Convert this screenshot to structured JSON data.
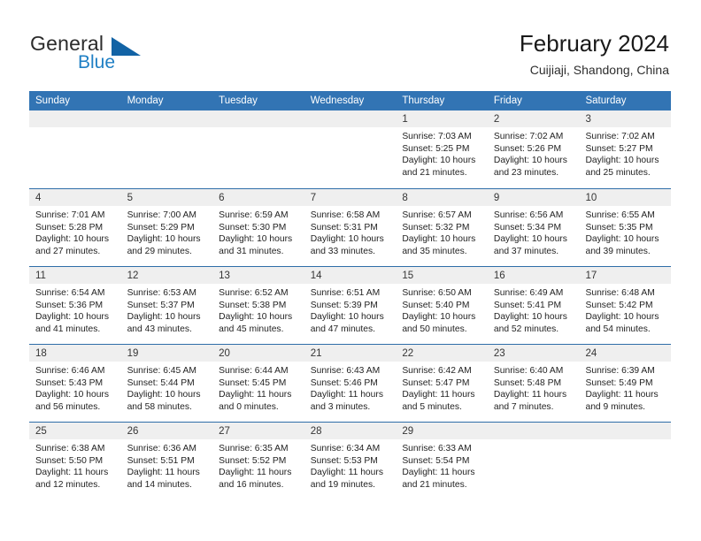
{
  "logo": {
    "word_top": "General",
    "word_bottom": "Blue",
    "accent_color": "#1263a5"
  },
  "header": {
    "title": "February 2024",
    "subtitle": "Cuijiaji, Shandong, China",
    "header_bg": "#3274b4",
    "row_divider": "#2f6da8",
    "daynum_band": "#efefef"
  },
  "weekdays": [
    "Sunday",
    "Monday",
    "Tuesday",
    "Wednesday",
    "Thursday",
    "Friday",
    "Saturday"
  ],
  "weeks": [
    [
      {
        "day": "",
        "empty": true
      },
      {
        "day": "",
        "empty": true
      },
      {
        "day": "",
        "empty": true
      },
      {
        "day": "",
        "empty": true
      },
      {
        "day": "1",
        "sunrise": "Sunrise: 7:03 AM",
        "sunset": "Sunset: 5:25 PM",
        "daylight1": "Daylight: 10 hours",
        "daylight2": "and 21 minutes."
      },
      {
        "day": "2",
        "sunrise": "Sunrise: 7:02 AM",
        "sunset": "Sunset: 5:26 PM",
        "daylight1": "Daylight: 10 hours",
        "daylight2": "and 23 minutes."
      },
      {
        "day": "3",
        "sunrise": "Sunrise: 7:02 AM",
        "sunset": "Sunset: 5:27 PM",
        "daylight1": "Daylight: 10 hours",
        "daylight2": "and 25 minutes."
      }
    ],
    [
      {
        "day": "4",
        "sunrise": "Sunrise: 7:01 AM",
        "sunset": "Sunset: 5:28 PM",
        "daylight1": "Daylight: 10 hours",
        "daylight2": "and 27 minutes."
      },
      {
        "day": "5",
        "sunrise": "Sunrise: 7:00 AM",
        "sunset": "Sunset: 5:29 PM",
        "daylight1": "Daylight: 10 hours",
        "daylight2": "and 29 minutes."
      },
      {
        "day": "6",
        "sunrise": "Sunrise: 6:59 AM",
        "sunset": "Sunset: 5:30 PM",
        "daylight1": "Daylight: 10 hours",
        "daylight2": "and 31 minutes."
      },
      {
        "day": "7",
        "sunrise": "Sunrise: 6:58 AM",
        "sunset": "Sunset: 5:31 PM",
        "daylight1": "Daylight: 10 hours",
        "daylight2": "and 33 minutes."
      },
      {
        "day": "8",
        "sunrise": "Sunrise: 6:57 AM",
        "sunset": "Sunset: 5:32 PM",
        "daylight1": "Daylight: 10 hours",
        "daylight2": "and 35 minutes."
      },
      {
        "day": "9",
        "sunrise": "Sunrise: 6:56 AM",
        "sunset": "Sunset: 5:34 PM",
        "daylight1": "Daylight: 10 hours",
        "daylight2": "and 37 minutes."
      },
      {
        "day": "10",
        "sunrise": "Sunrise: 6:55 AM",
        "sunset": "Sunset: 5:35 PM",
        "daylight1": "Daylight: 10 hours",
        "daylight2": "and 39 minutes."
      }
    ],
    [
      {
        "day": "11",
        "sunrise": "Sunrise: 6:54 AM",
        "sunset": "Sunset: 5:36 PM",
        "daylight1": "Daylight: 10 hours",
        "daylight2": "and 41 minutes."
      },
      {
        "day": "12",
        "sunrise": "Sunrise: 6:53 AM",
        "sunset": "Sunset: 5:37 PM",
        "daylight1": "Daylight: 10 hours",
        "daylight2": "and 43 minutes."
      },
      {
        "day": "13",
        "sunrise": "Sunrise: 6:52 AM",
        "sunset": "Sunset: 5:38 PM",
        "daylight1": "Daylight: 10 hours",
        "daylight2": "and 45 minutes."
      },
      {
        "day": "14",
        "sunrise": "Sunrise: 6:51 AM",
        "sunset": "Sunset: 5:39 PM",
        "daylight1": "Daylight: 10 hours",
        "daylight2": "and 47 minutes."
      },
      {
        "day": "15",
        "sunrise": "Sunrise: 6:50 AM",
        "sunset": "Sunset: 5:40 PM",
        "daylight1": "Daylight: 10 hours",
        "daylight2": "and 50 minutes."
      },
      {
        "day": "16",
        "sunrise": "Sunrise: 6:49 AM",
        "sunset": "Sunset: 5:41 PM",
        "daylight1": "Daylight: 10 hours",
        "daylight2": "and 52 minutes."
      },
      {
        "day": "17",
        "sunrise": "Sunrise: 6:48 AM",
        "sunset": "Sunset: 5:42 PM",
        "daylight1": "Daylight: 10 hours",
        "daylight2": "and 54 minutes."
      }
    ],
    [
      {
        "day": "18",
        "sunrise": "Sunrise: 6:46 AM",
        "sunset": "Sunset: 5:43 PM",
        "daylight1": "Daylight: 10 hours",
        "daylight2": "and 56 minutes."
      },
      {
        "day": "19",
        "sunrise": "Sunrise: 6:45 AM",
        "sunset": "Sunset: 5:44 PM",
        "daylight1": "Daylight: 10 hours",
        "daylight2": "and 58 minutes."
      },
      {
        "day": "20",
        "sunrise": "Sunrise: 6:44 AM",
        "sunset": "Sunset: 5:45 PM",
        "daylight1": "Daylight: 11 hours",
        "daylight2": "and 0 minutes."
      },
      {
        "day": "21",
        "sunrise": "Sunrise: 6:43 AM",
        "sunset": "Sunset: 5:46 PM",
        "daylight1": "Daylight: 11 hours",
        "daylight2": "and 3 minutes."
      },
      {
        "day": "22",
        "sunrise": "Sunrise: 6:42 AM",
        "sunset": "Sunset: 5:47 PM",
        "daylight1": "Daylight: 11 hours",
        "daylight2": "and 5 minutes."
      },
      {
        "day": "23",
        "sunrise": "Sunrise: 6:40 AM",
        "sunset": "Sunset: 5:48 PM",
        "daylight1": "Daylight: 11 hours",
        "daylight2": "and 7 minutes."
      },
      {
        "day": "24",
        "sunrise": "Sunrise: 6:39 AM",
        "sunset": "Sunset: 5:49 PM",
        "daylight1": "Daylight: 11 hours",
        "daylight2": "and 9 minutes."
      }
    ],
    [
      {
        "day": "25",
        "sunrise": "Sunrise: 6:38 AM",
        "sunset": "Sunset: 5:50 PM",
        "daylight1": "Daylight: 11 hours",
        "daylight2": "and 12 minutes."
      },
      {
        "day": "26",
        "sunrise": "Sunrise: 6:36 AM",
        "sunset": "Sunset: 5:51 PM",
        "daylight1": "Daylight: 11 hours",
        "daylight2": "and 14 minutes."
      },
      {
        "day": "27",
        "sunrise": "Sunrise: 6:35 AM",
        "sunset": "Sunset: 5:52 PM",
        "daylight1": "Daylight: 11 hours",
        "daylight2": "and 16 minutes."
      },
      {
        "day": "28",
        "sunrise": "Sunrise: 6:34 AM",
        "sunset": "Sunset: 5:53 PM",
        "daylight1": "Daylight: 11 hours",
        "daylight2": "and 19 minutes."
      },
      {
        "day": "29",
        "sunrise": "Sunrise: 6:33 AM",
        "sunset": "Sunset: 5:54 PM",
        "daylight1": "Daylight: 11 hours",
        "daylight2": "and 21 minutes."
      },
      {
        "day": "",
        "empty": true
      },
      {
        "day": "",
        "empty": true
      }
    ]
  ]
}
